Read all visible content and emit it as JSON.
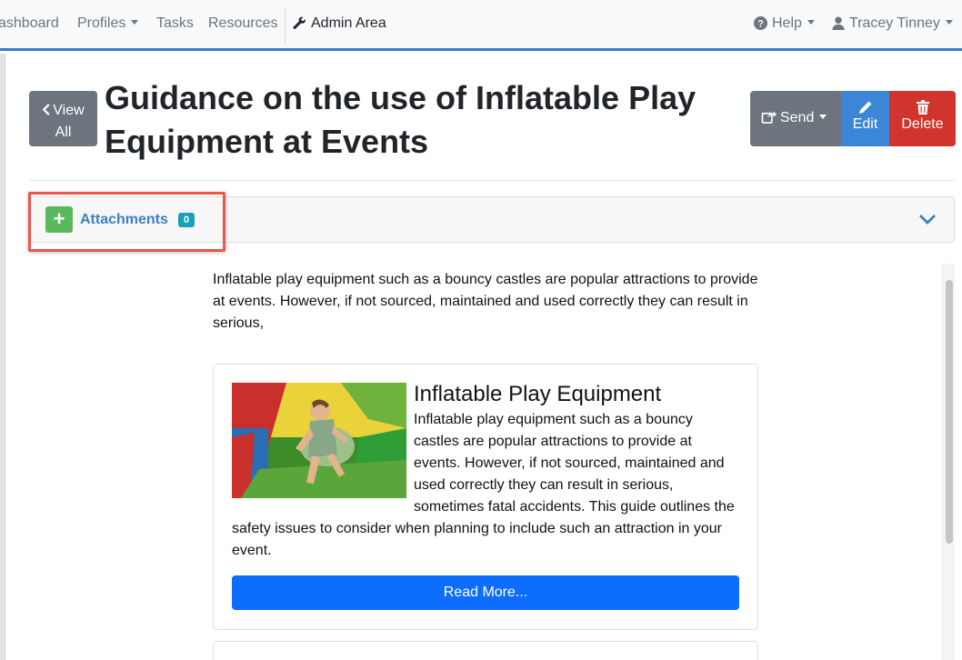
{
  "nav": {
    "dashboard": "ashboard",
    "profiles": "Profiles",
    "tasks": "Tasks",
    "resources": "Resources",
    "admin_area": "Admin Area",
    "help": "Help",
    "user": "Tracey Tinney"
  },
  "header": {
    "view_all_line1": "View",
    "view_all_line2": "All",
    "title": "Guidance on the use of Inflatable Play Equipment at Events",
    "send": "Send",
    "edit": "Edit",
    "delete": "Delete"
  },
  "attachments": {
    "label": "Attachments",
    "count": "0",
    "add_symbol": "+"
  },
  "content": {
    "intro": "Inflatable play equipment such as a bouncy castles are popular attractions to provide at events. However, if not sourced, maintained and used correctly they can result in serious,",
    "card": {
      "title": "Inflatable Play Equipment",
      "lines": [
        "Inflatable play equipment such as a bouncy",
        "castles are popular attractions to provide at",
        "events. However, if not sourced, maintained and",
        "used correctly they can result in serious,",
        "sometimes fatal accidents. This guide outlines the",
        "safety issues to consider when planning to include such an attraction in your",
        "event."
      ],
      "read_more": "Read More..."
    }
  },
  "colors": {
    "nav_accent": "#3a7bc8",
    "secondary": "#6c757d",
    "edit": "#3b86d6",
    "delete": "#d0342c",
    "add": "#5cb85c",
    "badge": "#17a2b8",
    "primary": "#0d6efd",
    "highlight": "#e8574a"
  },
  "icons": {
    "help": "question-circle-icon",
    "user": "user-icon",
    "admin": "wrench-icon",
    "view_all": "chevron-left-icon",
    "send": "share-icon",
    "edit": "pencil-icon",
    "delete": "trash-icon",
    "collapse": "chevron-down-icon"
  }
}
